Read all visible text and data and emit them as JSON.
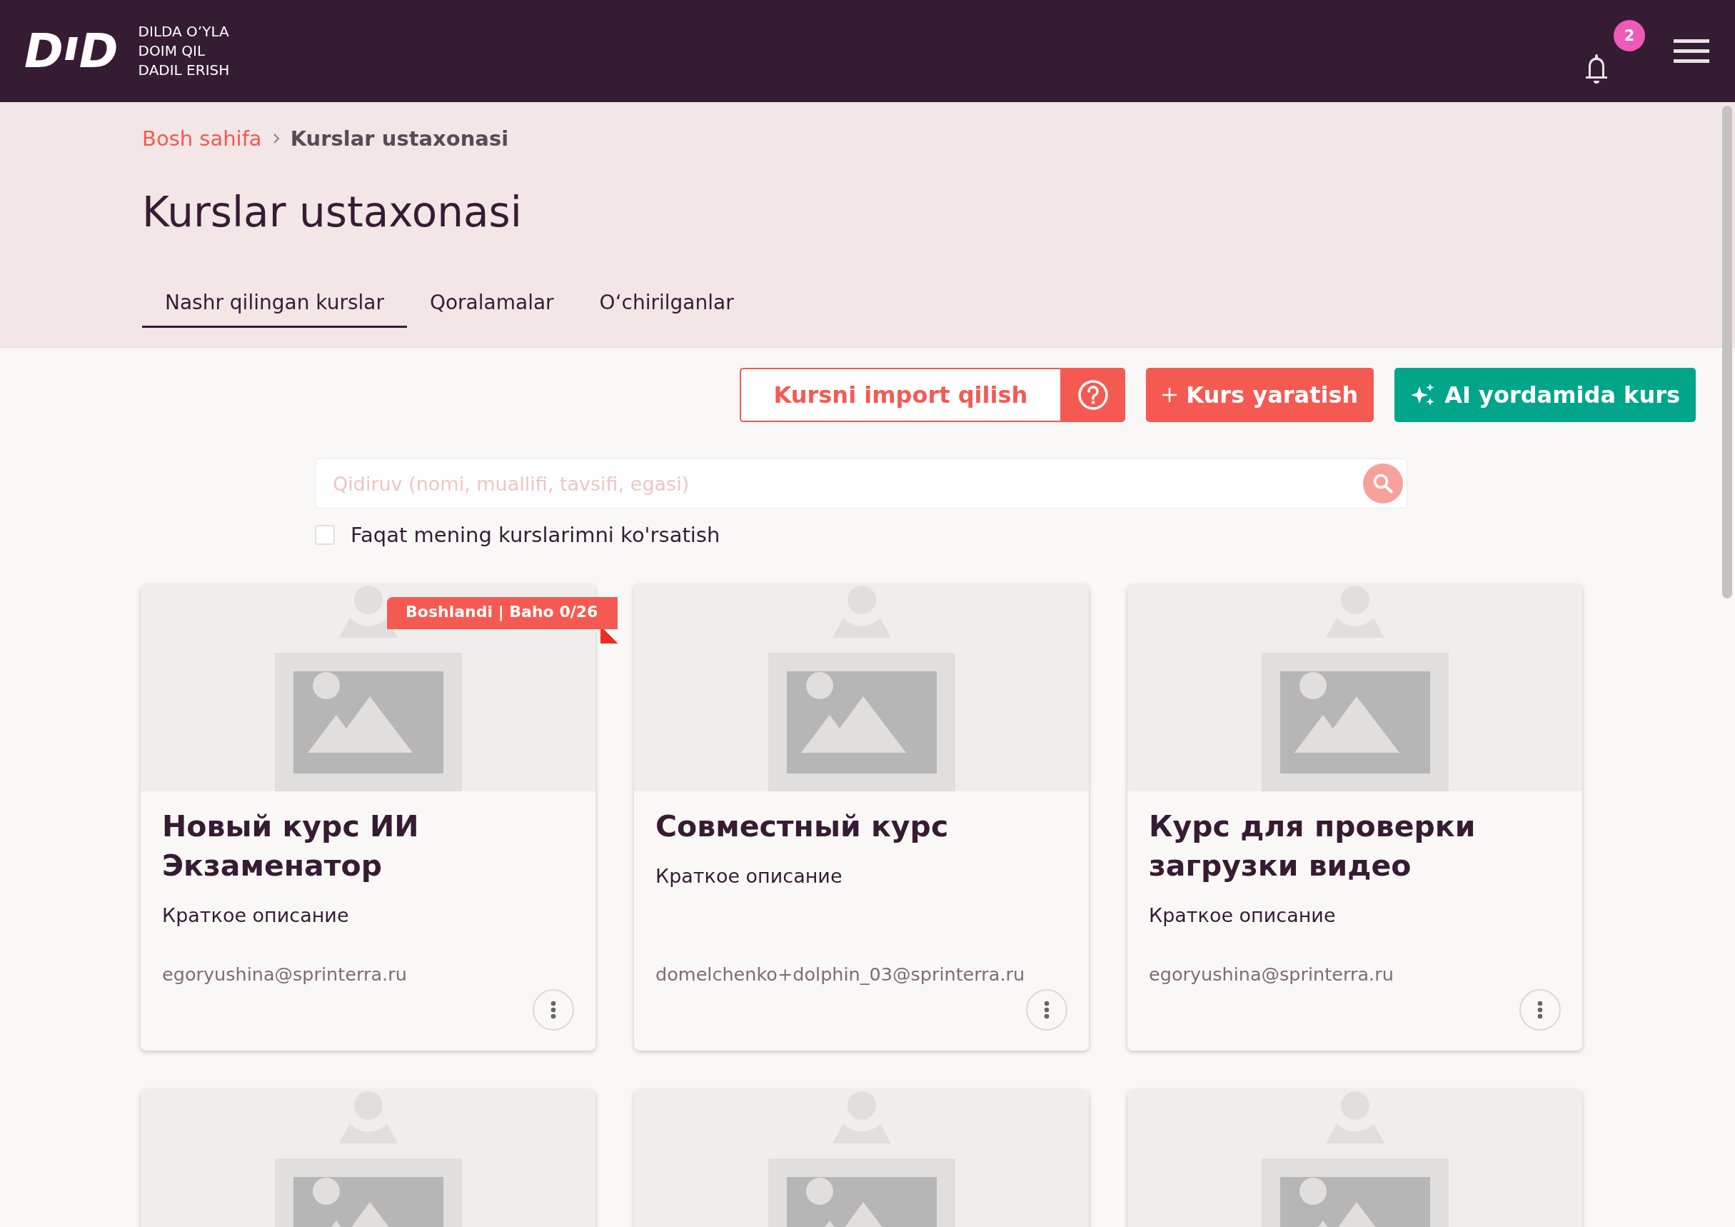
{
  "header": {
    "logo": {
      "left": "D",
      "right": "D"
    },
    "slogan": [
      "DILDA O’YLA",
      "DOIM QIL",
      "DADIL ERISH"
    ],
    "notifications": "2"
  },
  "breadcrumb": [
    {
      "label": "Bosh sahifa",
      "current": false
    },
    {
      "label": "Kurslar ustaxonasi",
      "current": true
    }
  ],
  "title": "Kurslar ustaxonasi",
  "tabs": [
    {
      "label": "Nashr qilingan kurslar",
      "selected": true
    },
    {
      "label": "Qoralamalar",
      "selected": false
    },
    {
      "label": "O‘chirilganlar",
      "selected": false
    }
  ],
  "actions": [
    {
      "kind": "import",
      "label": "Kursni import qilish"
    },
    {
      "kind": "create",
      "label": "Kurs yaratish"
    },
    {
      "kind": "ai",
      "label": "AI yordamida kurs"
    }
  ],
  "search": {
    "placeholder": "Qidiruv (nomi, muallifi, tavsifi, egasi)"
  },
  "filter": {
    "label": "Faqat mening kurslarimni ko'rsatish",
    "checked": false
  },
  "cards": [
    {
      "kind": "full",
      "badge": "Boshlandi | Baho 0/26",
      "title": "Новый курс ИИ Экзаменатор",
      "description": "Краткое описание",
      "owner": "egoryushina@sprinterra.ru"
    },
    {
      "kind": "full",
      "title": "Совместный курс",
      "description": "Краткое описание",
      "owner": "domelchenko+dolphin_03@sprinterra.ru"
    },
    {
      "kind": "full",
      "title": "Курс для проверки загрузки видео",
      "description": "Краткое описание",
      "owner": "egoryushina@sprinterra.ru"
    },
    {
      "kind": "partial"
    },
    {
      "kind": "partial"
    },
    {
      "kind": "partial"
    }
  ]
}
